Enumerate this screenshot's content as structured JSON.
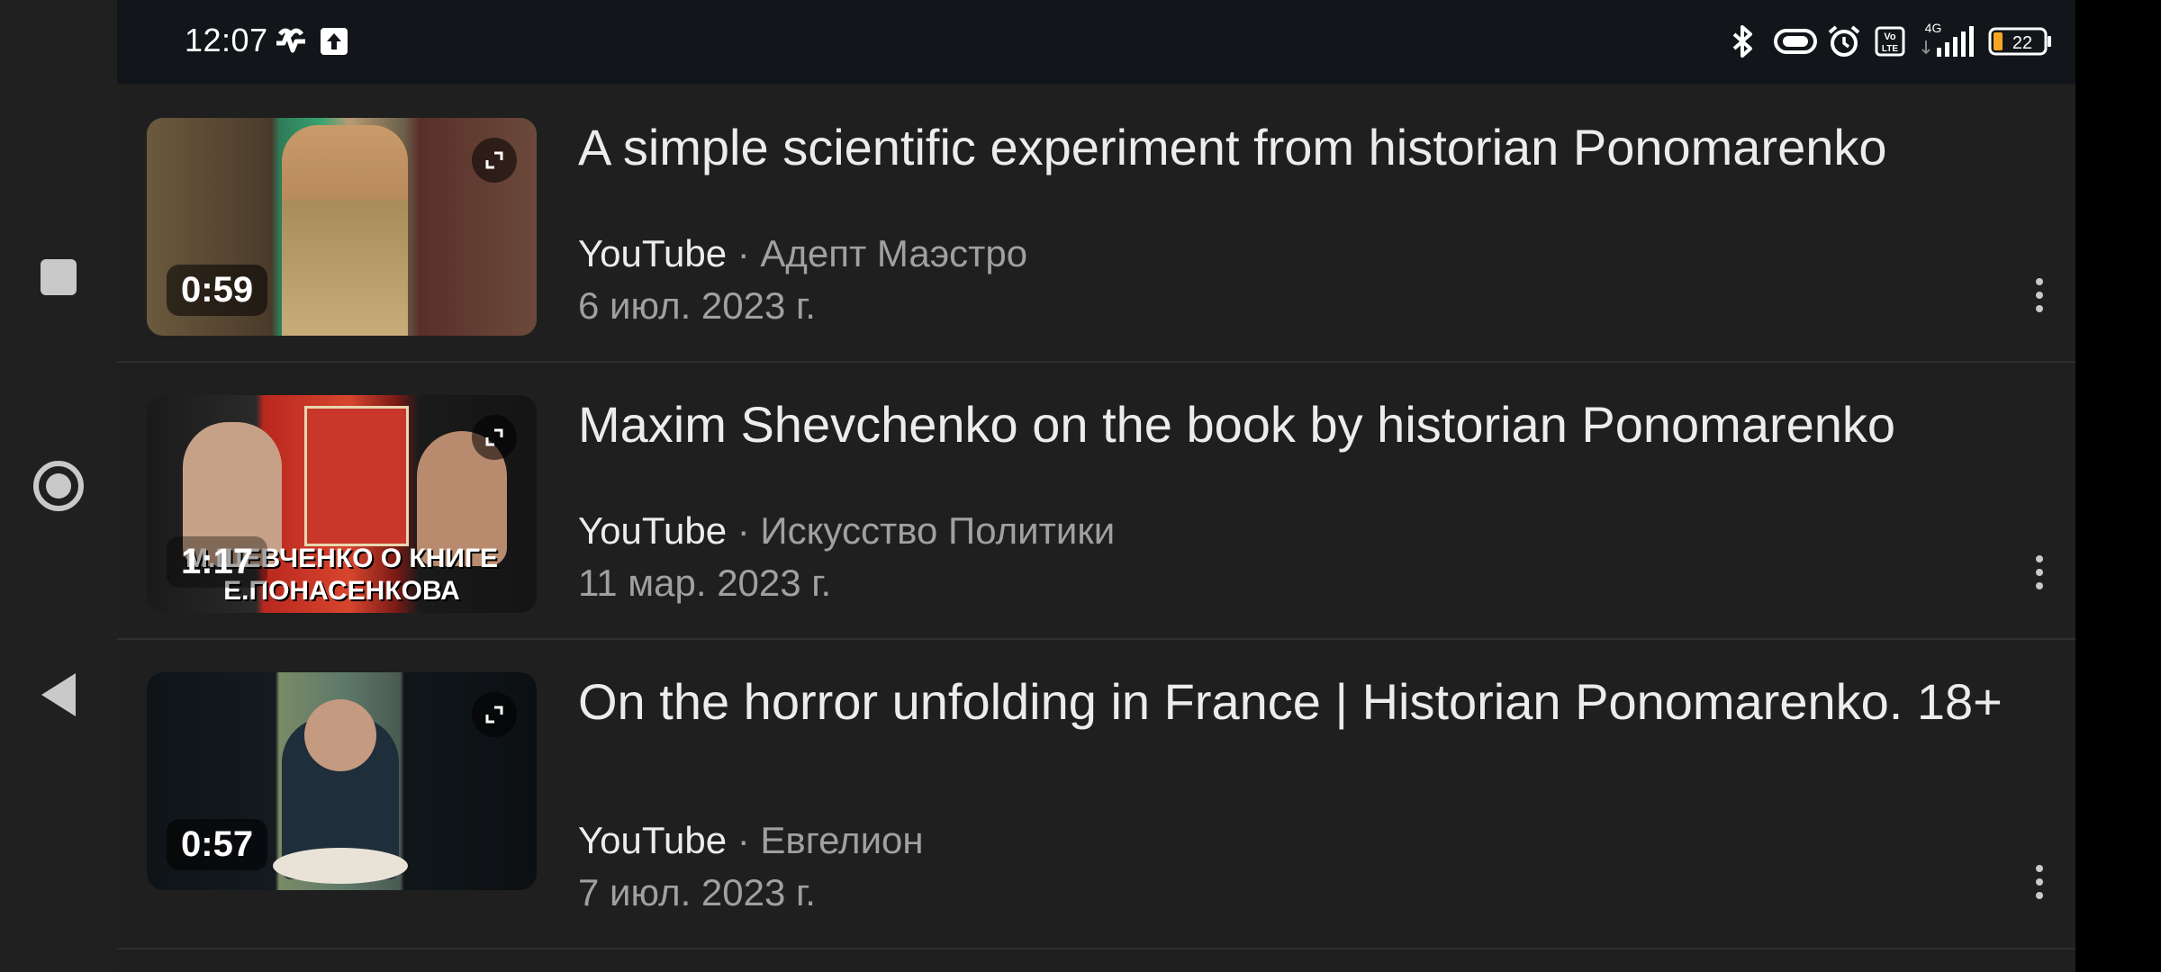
{
  "status_bar": {
    "time": "12:07",
    "icons": [
      "heart-pulse-icon",
      "upload-icon",
      "bluetooth-icon",
      "vibrate-icon",
      "alarm-icon",
      "volte-icon",
      "4g-signal-icon",
      "battery-icon"
    ],
    "network_label": "4G",
    "battery_level": "22"
  },
  "nav": {
    "recents": "recents-square-icon",
    "home": "home-circle-icon",
    "back": "back-triangle-icon"
  },
  "videos": [
    {
      "title": "A simple scientific experiment from historian Ponomarenko",
      "source": "YouTube",
      "separator": " · ",
      "channel": "Адепт Маэстро",
      "date": "6 июл. 2023 г.",
      "duration": "0:59",
      "thumb_text": ""
    },
    {
      "title": "Maxim Shevchenko on the book by historian Ponomarenko",
      "source": "YouTube",
      "separator": " · ",
      "channel": "Искусство Политики",
      "date": "11 мар. 2023 г.",
      "duration": "1:17",
      "thumb_text": "М.ШЕВЧЕНКО О КНИГЕ Е.ПОНАСЕНКОВА"
    },
    {
      "title": "On the horror unfolding in France | Historian Ponomarenko. 18+",
      "source": "YouTube",
      "separator": " · ",
      "channel": "Евгелион",
      "date": "7 июл. 2023 г.",
      "duration": "0:57",
      "thumb_text": ""
    }
  ],
  "colors": {
    "background": "#1f1f1f",
    "status_bar": "#121519",
    "battery_fill": "#f5a623"
  }
}
